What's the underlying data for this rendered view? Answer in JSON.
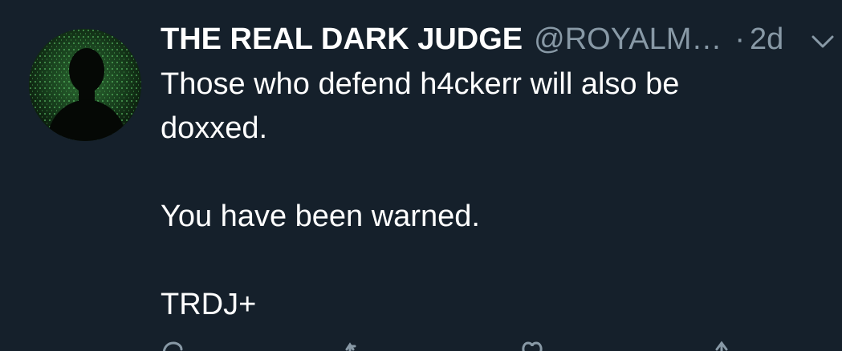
{
  "tweet": {
    "display_name": "THE REAL DARK JUDGE",
    "handle": "@ROYALM…",
    "separator": "·",
    "time": "2d",
    "lines": [
      "Those who defend h4ckerr will also be",
      "doxxed.",
      "",
      "You have been warned.",
      "",
      "TRDJ+"
    ]
  },
  "icons": {
    "avatar": "silhouette-avatar",
    "menu": "chevron-down-icon",
    "actions": [
      "reply-icon",
      "retweet-icon",
      "like-icon",
      "share-icon"
    ]
  },
  "colors": {
    "background": "#15202b",
    "primary_text": "#ffffff",
    "secondary_text": "#8899a6",
    "avatar_matrix": "#3fa34d"
  }
}
